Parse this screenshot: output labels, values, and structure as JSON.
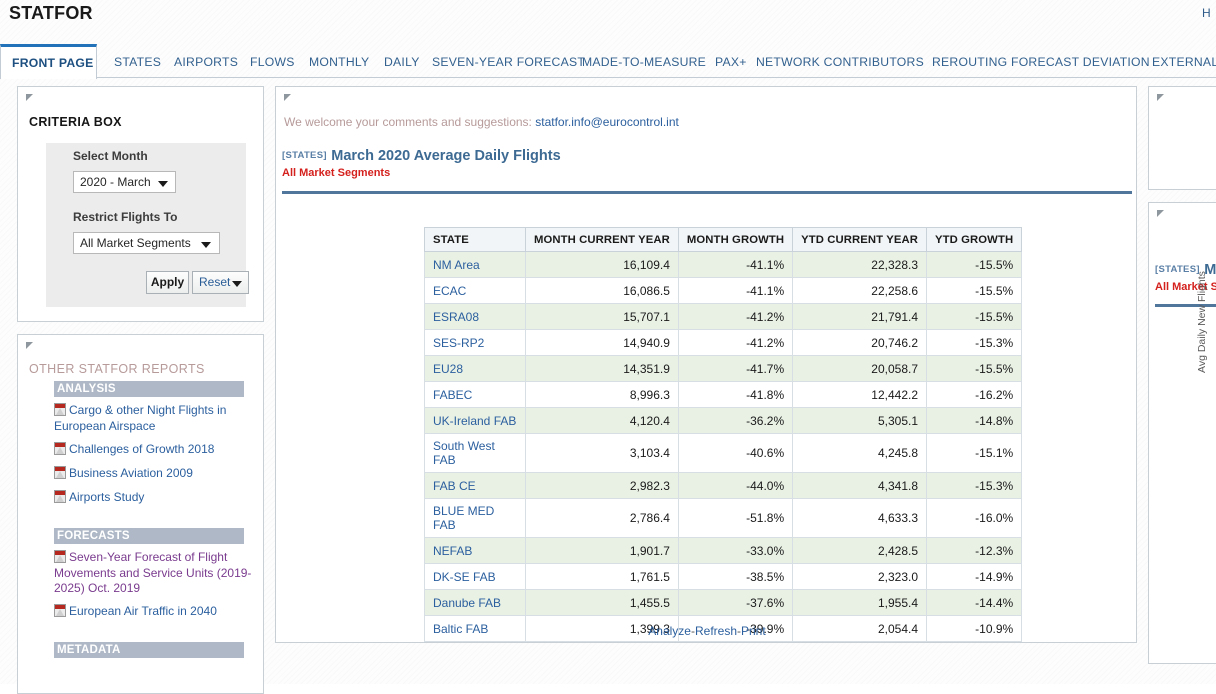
{
  "header": {
    "app_title": "STATFOR",
    "right_link": "H"
  },
  "tabs": [
    {
      "label": "FRONT PAGE",
      "active": true
    },
    {
      "label": "STATES",
      "active": false
    },
    {
      "label": "AIRPORTS",
      "active": false
    },
    {
      "label": "FLOWS",
      "active": false
    },
    {
      "label": "MONTHLY",
      "active": false
    },
    {
      "label": "DAILY",
      "active": false
    },
    {
      "label": "SEVEN-YEAR FORECAST",
      "active": false
    },
    {
      "label": "MADE-TO-MEASURE",
      "active": false
    },
    {
      "label": "PAX+",
      "active": false
    },
    {
      "label": "NETWORK CONTRIBUTORS",
      "active": false
    },
    {
      "label": "REROUTING",
      "active": false
    },
    {
      "label": "FORECAST DEVIATION",
      "active": false
    },
    {
      "label": "EXTERNAL",
      "active": false
    }
  ],
  "criteria": {
    "panel_title": "CRITERIA BOX",
    "month_label": "Select Month",
    "month_value": "2020 - March",
    "month_options": [
      "2020 - March"
    ],
    "segments_label": "Restrict Flights To",
    "segments_value": "All Market Segments",
    "segments_options": [
      "All Market Segments"
    ],
    "apply_label": "Apply",
    "reset_label": "Reset"
  },
  "reports": {
    "panel_title": "OTHER STATFOR REPORTS",
    "groups": [
      {
        "name": "ANALYSIS",
        "items": [
          {
            "label": "Cargo & other Night Flights in European Airspace",
            "style": "blue"
          },
          {
            "label": "Challenges of Growth 2018",
            "style": "blue"
          },
          {
            "label": "Business Aviation 2009",
            "style": "blue"
          },
          {
            "label": "Airports Study",
            "style": "blue"
          }
        ]
      },
      {
        "name": "FORECASTS",
        "items": [
          {
            "label": "Seven-Year Forecast of Flight Movements and Service Units (2019-2025) Oct. 2019",
            "style": "purple"
          },
          {
            "label": "European Air Traffic in 2040",
            "style": "blue"
          }
        ]
      },
      {
        "name": "METADATA",
        "items": []
      }
    ]
  },
  "main": {
    "welcome_text": "We welcome your comments and suggestions:",
    "welcome_email": "statfor.info@eurocontrol.int",
    "report_scope": "[STATES]",
    "report_title": "March 2020 Average Daily Flights",
    "report_subtitle": "All Market Segments",
    "actions": {
      "analyze": "Analyze",
      "refresh": "Refresh",
      "print": "Print",
      "separator": "-"
    }
  },
  "right_panel": {
    "report_scope": "[STATES]",
    "report_title": "Ma",
    "report_subtitle": "All Market S",
    "yaxis_label": "Avg Daily New Flights"
  },
  "chart_data": {
    "type": "table",
    "title": "March 2020 Average Daily Flights",
    "subtitle": "All Market Segments",
    "columns": [
      "STATE",
      "MONTH CURRENT YEAR",
      "MONTH GROWTH",
      "YTD CURRENT YEAR",
      "YTD GROWTH"
    ],
    "rows": [
      {
        "state": "NM Area",
        "month_current_year": "16,109.4",
        "month_growth": "-41.1%",
        "ytd_current_year": "22,328.3",
        "ytd_growth": "-15.5%"
      },
      {
        "state": "ECAC",
        "month_current_year": "16,086.5",
        "month_growth": "-41.1%",
        "ytd_current_year": "22,258.6",
        "ytd_growth": "-15.5%"
      },
      {
        "state": "ESRA08",
        "month_current_year": "15,707.1",
        "month_growth": "-41.2%",
        "ytd_current_year": "21,791.4",
        "ytd_growth": "-15.5%"
      },
      {
        "state": "SES-RP2",
        "month_current_year": "14,940.9",
        "month_growth": "-41.2%",
        "ytd_current_year": "20,746.2",
        "ytd_growth": "-15.3%"
      },
      {
        "state": "EU28",
        "month_current_year": "14,351.9",
        "month_growth": "-41.7%",
        "ytd_current_year": "20,058.7",
        "ytd_growth": "-15.5%"
      },
      {
        "state": "FABEC",
        "month_current_year": "8,996.3",
        "month_growth": "-41.8%",
        "ytd_current_year": "12,442.2",
        "ytd_growth": "-16.2%"
      },
      {
        "state": "UK-Ireland FAB",
        "month_current_year": "4,120.4",
        "month_growth": "-36.2%",
        "ytd_current_year": "5,305.1",
        "ytd_growth": "-14.8%"
      },
      {
        "state": "South West FAB",
        "month_current_year": "3,103.4",
        "month_growth": "-40.6%",
        "ytd_current_year": "4,245.8",
        "ytd_growth": "-15.1%"
      },
      {
        "state": "FAB CE",
        "month_current_year": "2,982.3",
        "month_growth": "-44.0%",
        "ytd_current_year": "4,341.8",
        "ytd_growth": "-15.3%"
      },
      {
        "state": "BLUE MED FAB",
        "month_current_year": "2,786.4",
        "month_growth": "-51.8%",
        "ytd_current_year": "4,633.3",
        "ytd_growth": "-16.0%"
      },
      {
        "state": "NEFAB",
        "month_current_year": "1,901.7",
        "month_growth": "-33.0%",
        "ytd_current_year": "2,428.5",
        "ytd_growth": "-12.3%"
      },
      {
        "state": "DK-SE FAB",
        "month_current_year": "1,761.5",
        "month_growth": "-38.5%",
        "ytd_current_year": "2,323.0",
        "ytd_growth": "-14.9%"
      },
      {
        "state": "Danube FAB",
        "month_current_year": "1,455.5",
        "month_growth": "-37.6%",
        "ytd_current_year": "1,955.4",
        "ytd_growth": "-14.4%"
      },
      {
        "state": "Baltic FAB",
        "month_current_year": "1,399.3",
        "month_growth": "-39.9%",
        "ytd_current_year": "2,054.4",
        "ytd_growth": "-10.9%"
      }
    ]
  },
  "colors": {
    "accent_blue": "#2172b8",
    "link_blue": "#2b5f9e",
    "title_blue": "#3d6a93",
    "alert_red": "#d4211e",
    "row_alt_green": "#e9f1e5",
    "group_header": "#aeb8c6"
  }
}
